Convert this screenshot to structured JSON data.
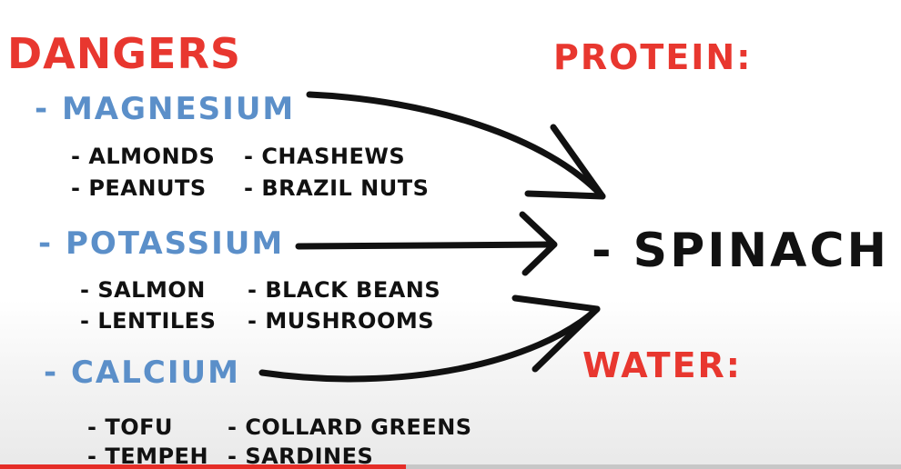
{
  "board": {
    "dangers_title": "DANGERS",
    "protein_title": "PROTEIN:",
    "water_title": "WATER:",
    "magnesium": {
      "label": "- MAGNESIUM",
      "items": [
        "- ALMONDS",
        "- CHASHEWS",
        "- PEANUTS",
        "- BRAZIL NUTS"
      ]
    },
    "potassium": {
      "label": "- POTASSIUM",
      "items": [
        "- SALMON",
        "- BLACK BEANS",
        "- LENTILES",
        "- MUSHROOMS"
      ]
    },
    "calcium": {
      "label": "- CALCIUM",
      "items": [
        "- TOFU",
        "- COLLARD GREENS",
        "- TEMPEH",
        "- SARDINES"
      ]
    },
    "target": "- SPINACH"
  },
  "colors": {
    "red": "#e8372f",
    "blue": "#5b8fc9",
    "ink": "#111111",
    "progress": "#e52d27"
  },
  "video": {
    "progress_fraction": 0.45
  }
}
